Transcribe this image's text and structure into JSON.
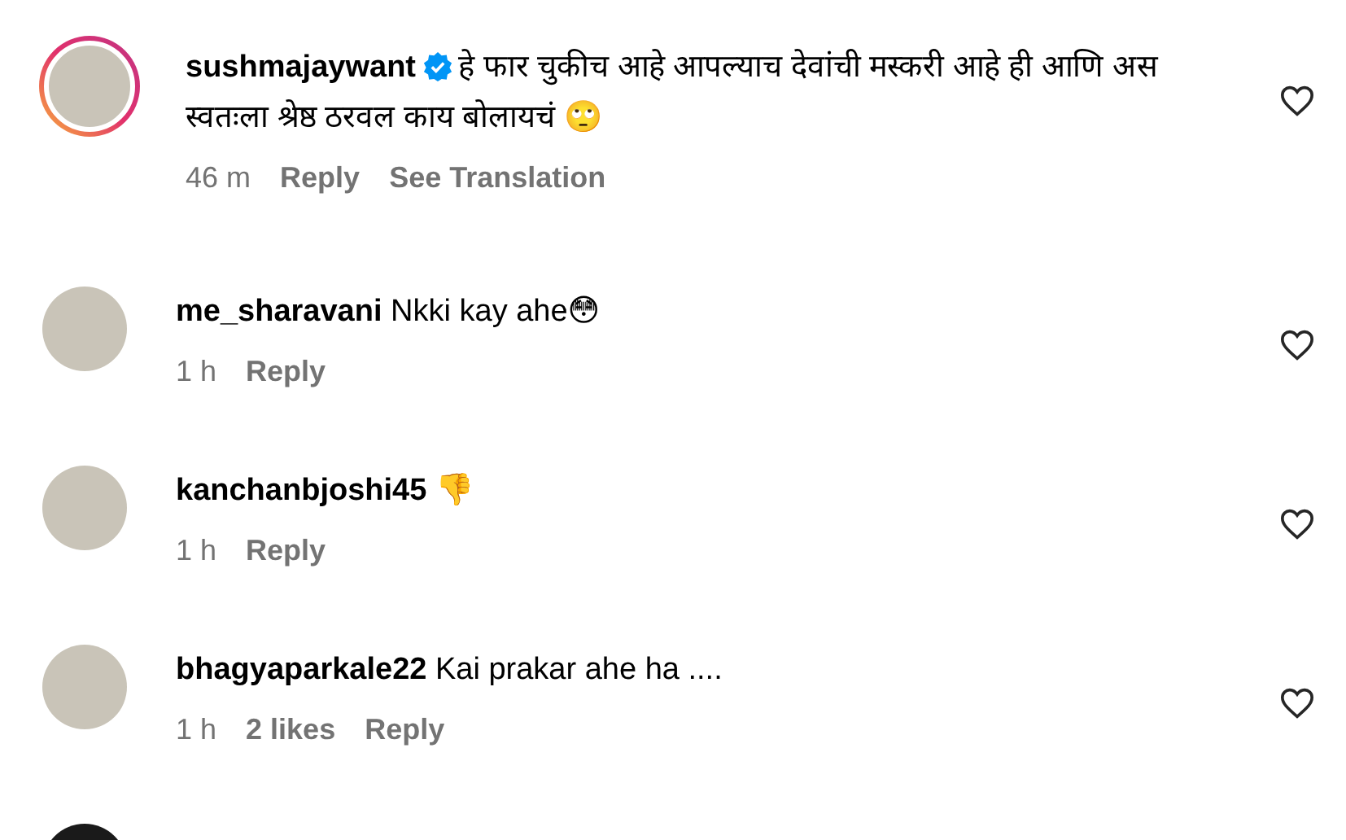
{
  "comments": [
    {
      "username": "sushmajaywant",
      "verified": true,
      "has_story": true,
      "text": "हे फार चुकीच आहे आपल्याच देवांची मस्करी आहे ही आणि अस स्वतःला श्रेष्ठ ठरवल काय बोलायचं 🙄",
      "time": "46 m",
      "reply": "Reply",
      "translation": "See Translation"
    },
    {
      "username": "me_sharavani",
      "verified": false,
      "has_story": false,
      "text": "Nkki kay ahe😳",
      "time": "1 h",
      "reply": "Reply"
    },
    {
      "username": "kanchanbjoshi45",
      "verified": false,
      "has_story": false,
      "text": "👎",
      "time": "1 h",
      "reply": "Reply"
    },
    {
      "username": "bhagyaparkale22",
      "verified": false,
      "has_story": false,
      "text": "Kai prakar ahe ha ....",
      "time": "1 h",
      "likes": "2 likes",
      "reply": "Reply"
    }
  ]
}
